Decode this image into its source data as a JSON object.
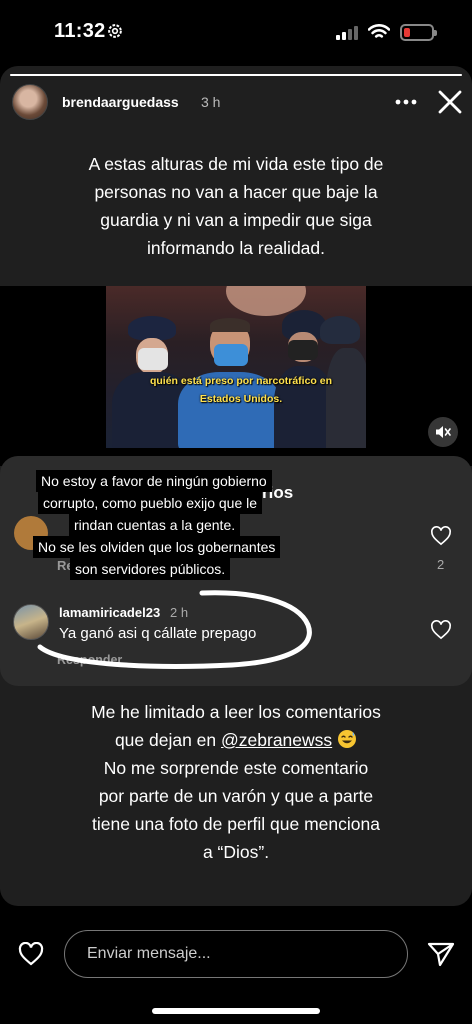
{
  "status_bar": {
    "time": "11:32",
    "signal_bars": 4,
    "signal_active": 2,
    "battery_level": 0.15,
    "battery_color": "#e53935"
  },
  "story": {
    "progress": 1.0,
    "username": "brendaarguedass",
    "time_ago": "3 h",
    "top_caption_lines": [
      "A estas alturas de mi vida este tipo de",
      "personas no van a hacer que baje la",
      "guardia y ni van a impedir que siga",
      "informando la realidad."
    ],
    "photo_caption_lines": [
      "quién está preso por narcotráfico en",
      "Estados Unidos."
    ],
    "photo_caption_color": "#ffe14d"
  },
  "comments": {
    "title_fragment": "rios",
    "hidden_comment_reply_fragment": "Re",
    "hidden_comment_likes": "2",
    "overlay_lines": [
      "No estoy a favor de ningún gobierno",
      "corrupto, como pueblo exijo que le",
      "rindan  cuentas a la gente.",
      "No se les olviden que los gobernantes",
      "son servidores públicos."
    ],
    "comment2": {
      "username": "lamamiricadel23",
      "time_ago": "2 h",
      "text": "Ya ganó asi q cállate prepago",
      "reply_label": "Responder"
    }
  },
  "bottom_caption": {
    "line1": "Me he limitado a leer los comentarios",
    "line2_prefix": "que dejan en ",
    "mention": "@zebranewss",
    "line3": "No me sorprende este comentario",
    "line4": "por parte de un varón y que a parte",
    "line5": "tiene una foto de perfil que menciona",
    "line6": "a “Dios”."
  },
  "message_bar": {
    "placeholder": "Enviar mensaje..."
  }
}
